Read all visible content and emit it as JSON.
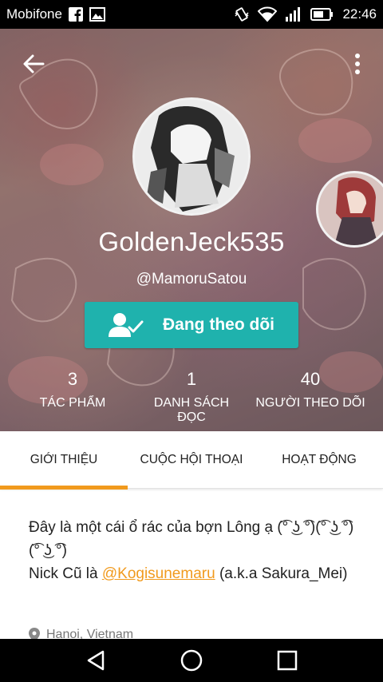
{
  "status_bar": {
    "carrier": "Mobifone",
    "time": "22:46",
    "icons": [
      "facebook-icon",
      "image-icon",
      "vibrate-icon",
      "wifi-icon",
      "signal-icon",
      "battery-icon"
    ]
  },
  "profile": {
    "display_name": "GoldenJeck535",
    "handle": "@MamoruSatou",
    "follow_button_label": "Đang theo dõi"
  },
  "stats": [
    {
      "value": "3",
      "label": "TÁC PHẨM"
    },
    {
      "value": "1",
      "label": "DANH SÁCH ĐỌC"
    },
    {
      "value": "40",
      "label": "NGƯỜI THEO DÕI"
    }
  ],
  "tabs": [
    {
      "label": "GIỚI THIỆU",
      "active": true
    },
    {
      "label": "CUỘC HỘI THOẠI",
      "active": false
    },
    {
      "label": "HOẠT ĐỘNG",
      "active": false
    }
  ],
  "about": {
    "line1": "Đây là một cái ổ rác của bợn Lông ạ (͡° ͜ʖ ͡°)(͡° ͜ʖ ͡°)(͡° ͜ʖ ͡°)",
    "line2_prefix": "Nick Cũ là ",
    "mention": "@Kogisunemaru",
    "line2_suffix": " (a.k.a Sakura_Mei)",
    "location": "Hanoi, Vietnam"
  },
  "colors": {
    "accent": "#f19a1d",
    "follow_button": "#1fb2ad"
  }
}
